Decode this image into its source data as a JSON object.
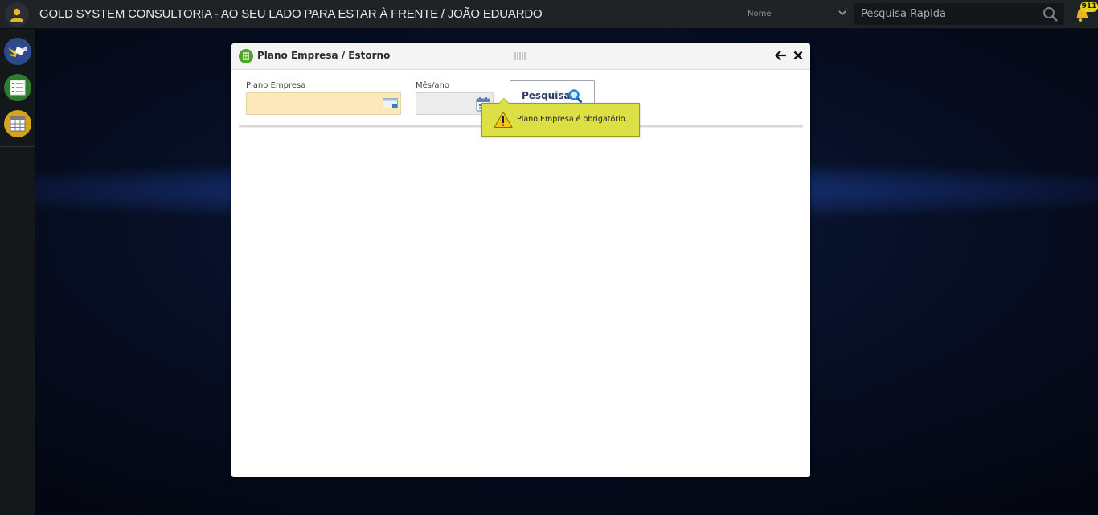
{
  "header": {
    "title": "GOLD SYSTEM CONSULTORIA - AO SEU LADO PARA ESTAR À FRENTE / JOÃO EDUARDO",
    "search_type": "Nome",
    "search_placeholder": "Pesquisa Rapida",
    "notification_count": "911"
  },
  "sidebar": {
    "items": [
      {
        "icon": "satellite-icon",
        "color": "#2d4a8a"
      },
      {
        "icon": "list-icon",
        "color": "#2e7d2e"
      },
      {
        "icon": "grid-icon",
        "color": "#d4a41a"
      }
    ]
  },
  "modal": {
    "title": "Plano Empresa / Estorno",
    "fields": {
      "plano_label": "Plano Empresa",
      "plano_value": "",
      "mes_label": "Mês/ano",
      "mes_value": ""
    },
    "search_button": "Pesquisar"
  },
  "tooltip": {
    "message": "Plano Empresa é obrigatório."
  },
  "colors": {
    "topbar": "#1f2326",
    "required_field": "#fce8b8",
    "tooltip_bg": "#dde045",
    "accent_green": "#4aa62a"
  }
}
